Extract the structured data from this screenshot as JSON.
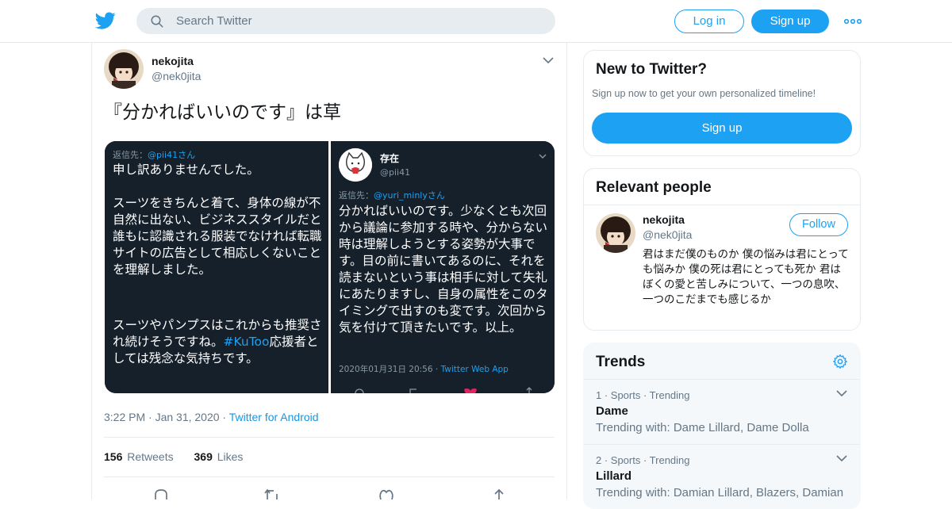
{
  "header": {
    "search_placeholder": "Search Twitter",
    "login_label": "Log in",
    "signup_label": "Sign up"
  },
  "tweet": {
    "author_name": "nekojita",
    "author_handle": "@nek0jita",
    "text": "『分かればいいのです』は草",
    "timestamp": "3:22 PM · Jan 31, 2020 · ",
    "source": "Twitter for Android",
    "retweets_count": "156",
    "retweets_label": "Retweets",
    "likes_count": "369",
    "likes_label": "Likes"
  },
  "media": {
    "left": {
      "reply_prefix": "返信先：",
      "reply_to": "@pii41さん",
      "text_top": "申し訳ありませんでした。\n\nスーツをきちんと着て、身体の線が不自然に出ない、ビジネススタイルだと誰もに認識される服装でなければ転職サイトの広告として相応しくないことを理解しました。",
      "text_bottom_1": "スーツやパンプスはこれからも推奨され続けそうですね。",
      "hashtag": "#KuToo",
      "text_bottom_2": "応援者としては残念な気持ちです。"
    },
    "right": {
      "name": "存在",
      "handle": "@pii41",
      "reply_prefix": "返信先：",
      "reply_to": "@yuri_minlyさん",
      "text": "分かればいいのです。少なくとも次回から議論に参加する時や、分からない時は理解しようとする姿勢が大事です。目の前に書いてあるのに、それを読まないという事は相手に対して失礼にあたりますし、自身の属性をこのタイミングで出すのも変です。次回から気を付けて頂きたいです。以上。",
      "meta": "2020年01月31日 20:56 · ",
      "app": "Twitter Web App"
    }
  },
  "sidebar": {
    "new_title": "New to Twitter?",
    "new_desc": "Sign up now to get your own personalized timeline!",
    "new_signup": "Sign up",
    "people_title": "Relevant people",
    "person": {
      "name": "nekojita",
      "handle": "@nek0jita",
      "follow_label": "Follow",
      "bio": "君はまだ僕のものか 僕の悩みは君にとっても悩みか 僕の死は君にとっても死か 君はぼくの愛と苦しみについて、一つの息吹、一つのこだまでも感じるか"
    },
    "trends_title": "Trends",
    "trends": [
      {
        "meta": "1 · Sports · Trending",
        "name": "Dame",
        "with": "Trending with: Dame Lillard, Dame Dolla"
      },
      {
        "meta": "2 · Sports · Trending",
        "name": "Lillard",
        "with": "Trending with: Damian Lillard, Blazers, Damian"
      }
    ]
  },
  "colors": {
    "brand": "#1da1f2",
    "secondary_text": "#657786",
    "dark_bg": "#15202b"
  },
  "icons": [
    "twitter-logo-icon",
    "search-icon",
    "more-icon",
    "chevron-down-icon",
    "reply-icon",
    "retweet-icon",
    "like-icon",
    "share-icon",
    "gear-icon"
  ]
}
